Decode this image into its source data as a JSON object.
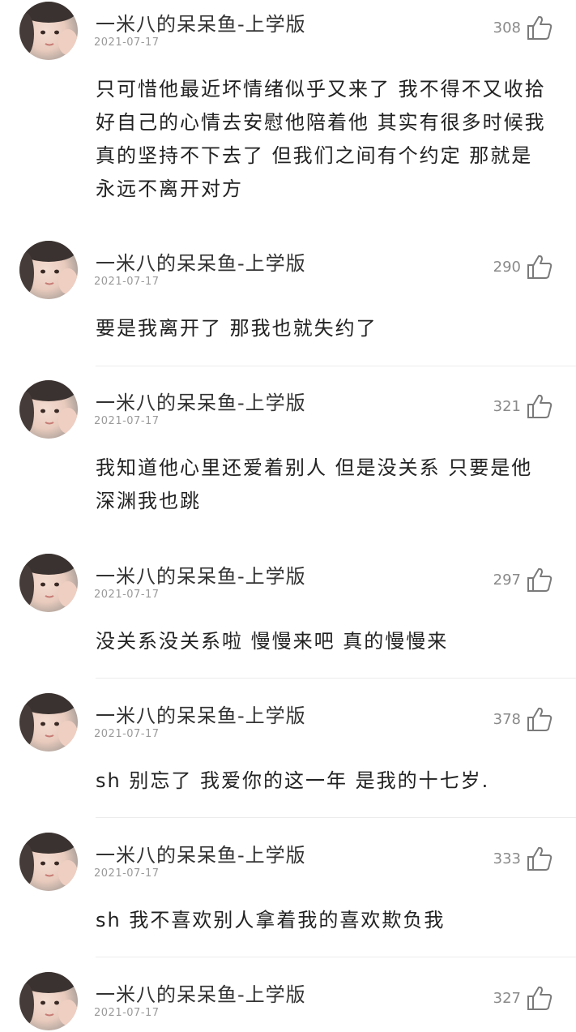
{
  "comments": [
    {
      "username": "一米八的呆呆鱼-上学版",
      "date": "2021-07-17",
      "likes": "308",
      "content": "只可惜他最近坏情绪似乎又来了 我不得不又收拾好自己的心情去安慰他陪着他 其实有很多时候我真的坚持不下去了 但我们之间有个约定 那就是永远不离开对方"
    },
    {
      "username": "一米八的呆呆鱼-上学版",
      "date": "2021-07-17",
      "likes": "290",
      "content": "要是我离开了 那我也就失约了"
    },
    {
      "username": "一米八的呆呆鱼-上学版",
      "date": "2021-07-17",
      "likes": "321",
      "content": "我知道他心里还爱着别人 但是没关系 只要是他深渊我也跳"
    },
    {
      "username": "一米八的呆呆鱼-上学版",
      "date": "2021-07-17",
      "likes": "297",
      "content": "没关系没关系啦 慢慢来吧 真的慢慢来"
    },
    {
      "username": "一米八的呆呆鱼-上学版",
      "date": "2021-07-17",
      "likes": "378",
      "content": "sh 别忘了 我爱你的这一年 是我的十七岁."
    },
    {
      "username": "一米八的呆呆鱼-上学版",
      "date": "2021-07-17",
      "likes": "333",
      "content": "sh 我不喜欢别人拿着我的喜欢欺负我"
    },
    {
      "username": "一米八的呆呆鱼-上学版",
      "date": "2021-07-17",
      "likes": "327",
      "content": ""
    }
  ],
  "icons": {
    "like": "thumbs-up-icon",
    "avatar": "user-avatar"
  }
}
